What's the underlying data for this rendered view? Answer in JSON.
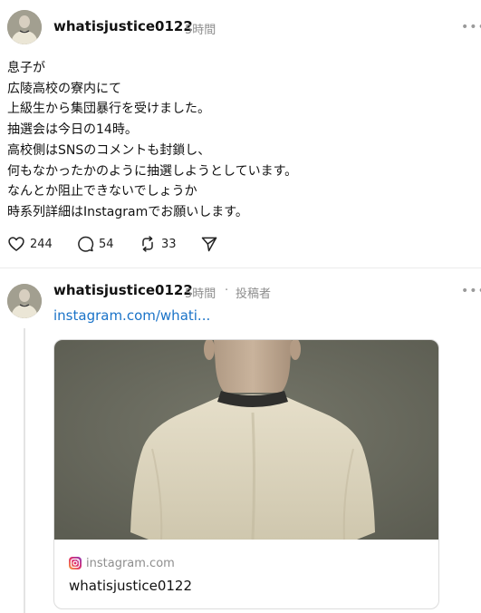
{
  "post1": {
    "username": "whatisjustice0122",
    "time": "5時間",
    "more_icon": "more-horizontal-icon",
    "lines": [
      "息子が",
      "広陵高校の寮内にて",
      "上級生から集団暴行を受けました。",
      "抽選会は今日の14時。",
      "高校側はSNSのコメントも封鎖し、",
      "何もなかったかのように抽選しようとしています。",
      "なんとか阻止できないでしょうか",
      "時系列詳細はInstagramでお願いします。"
    ],
    "actions": {
      "like_icon": "heart-icon",
      "like_count": "244",
      "comment_icon": "comment-icon",
      "comment_count": "54",
      "repost_icon": "repost-icon",
      "repost_count": "33",
      "share_icon": "send-icon"
    }
  },
  "post2": {
    "username": "whatisjustice0122",
    "time": "5時間",
    "separator": "·",
    "author_label": "投稿者",
    "more_icon": "more-horizontal-icon",
    "link_text": "instagram.com/whati...",
    "card": {
      "favicon": "instagram-icon",
      "domain": "instagram.com",
      "title": "whatisjustice0122"
    }
  },
  "colors": {
    "link": "#1a73c8",
    "muted": "#8e8e8e",
    "text": "#111111"
  }
}
